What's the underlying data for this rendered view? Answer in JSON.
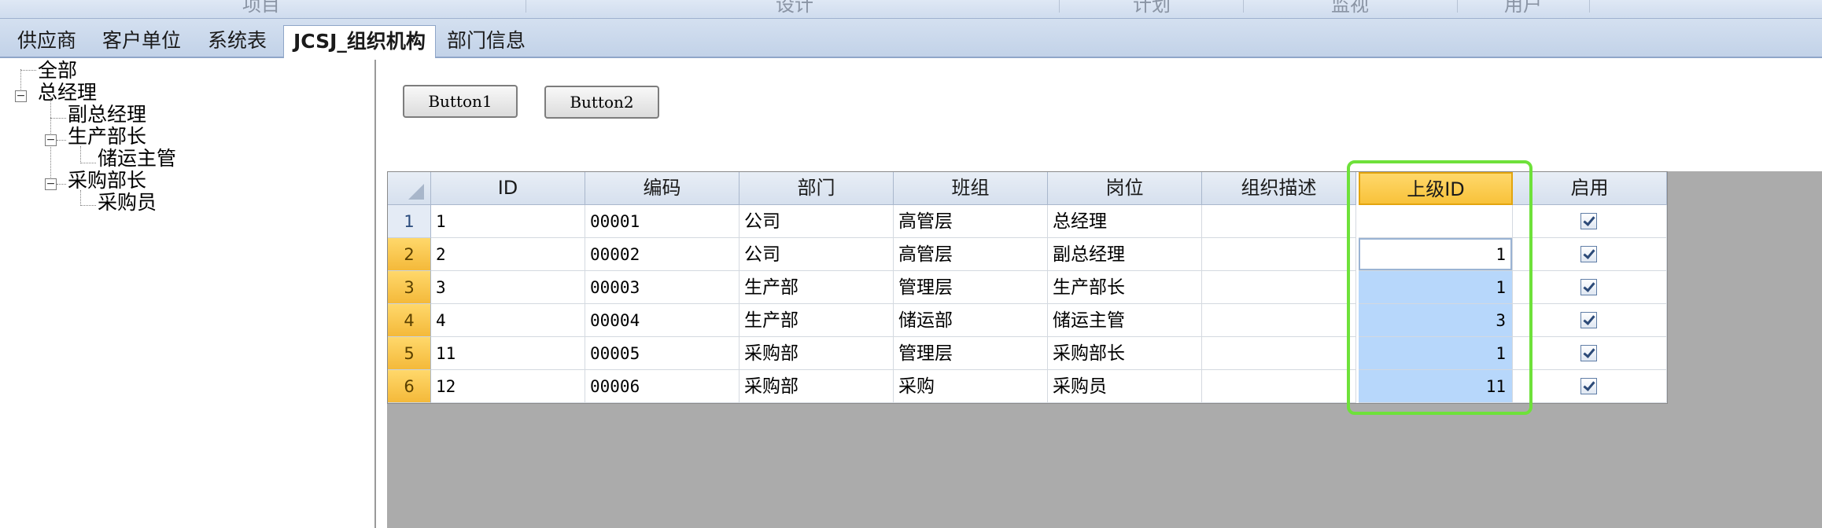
{
  "top_menu": {
    "items": [
      "项目",
      "设计",
      "计划",
      "监视",
      "用户"
    ]
  },
  "tabs": [
    {
      "label": "供应商",
      "active": false
    },
    {
      "label": "客户单位",
      "active": false
    },
    {
      "label": "系统表",
      "active": false
    },
    {
      "label": "JCSJ_组织机构",
      "active": true
    },
    {
      "label": "部门信息",
      "active": false
    }
  ],
  "tree": {
    "nodes": [
      {
        "label": "全部",
        "level": 0,
        "expander": "none"
      },
      {
        "label": "总经理",
        "level": 0,
        "expander": "minus"
      },
      {
        "label": "副总经理",
        "level": 1,
        "expander": "none"
      },
      {
        "label": "生产部长",
        "level": 1,
        "expander": "minus"
      },
      {
        "label": "储运主管",
        "level": 2,
        "expander": "none"
      },
      {
        "label": "采购部长",
        "level": 1,
        "expander": "minus"
      },
      {
        "label": "采购员",
        "level": 2,
        "expander": "none"
      }
    ]
  },
  "buttons": {
    "button1": "Button1",
    "button2": "Button2"
  },
  "grid": {
    "columns": [
      "ID",
      "编码",
      "部门",
      "班组",
      "岗位",
      "组织描述",
      "上级ID",
      "启用"
    ],
    "selected_column": "上级ID",
    "rows": [
      {
        "num": "1",
        "id": "1",
        "code": "00001",
        "dept": "公司",
        "team": "高管层",
        "post": "总经理",
        "desc": "",
        "parent": "",
        "enabled": true
      },
      {
        "num": "2",
        "id": "2",
        "code": "00002",
        "dept": "公司",
        "team": "高管层",
        "post": "副总经理",
        "desc": "",
        "parent": "1",
        "enabled": true
      },
      {
        "num": "3",
        "id": "3",
        "code": "00003",
        "dept": "生产部",
        "team": "管理层",
        "post": "生产部长",
        "desc": "",
        "parent": "1",
        "enabled": true
      },
      {
        "num": "4",
        "id": "4",
        "code": "00004",
        "dept": "生产部",
        "team": "储运部",
        "post": "储运主管",
        "desc": "",
        "parent": "3",
        "enabled": true
      },
      {
        "num": "5",
        "id": "11",
        "code": "00005",
        "dept": "采购部",
        "team": "管理层",
        "post": "采购部长",
        "desc": "",
        "parent": "1",
        "enabled": true
      },
      {
        "num": "6",
        "id": "12",
        "code": "00006",
        "dept": "采购部",
        "team": "采购",
        "post": "采购员",
        "desc": "",
        "parent": "11",
        "enabled": true
      }
    ]
  },
  "colors": {
    "highlight_box": "#6ee13a",
    "selected_header": "#f8c23a",
    "selected_cells": "#b7d7fb"
  }
}
